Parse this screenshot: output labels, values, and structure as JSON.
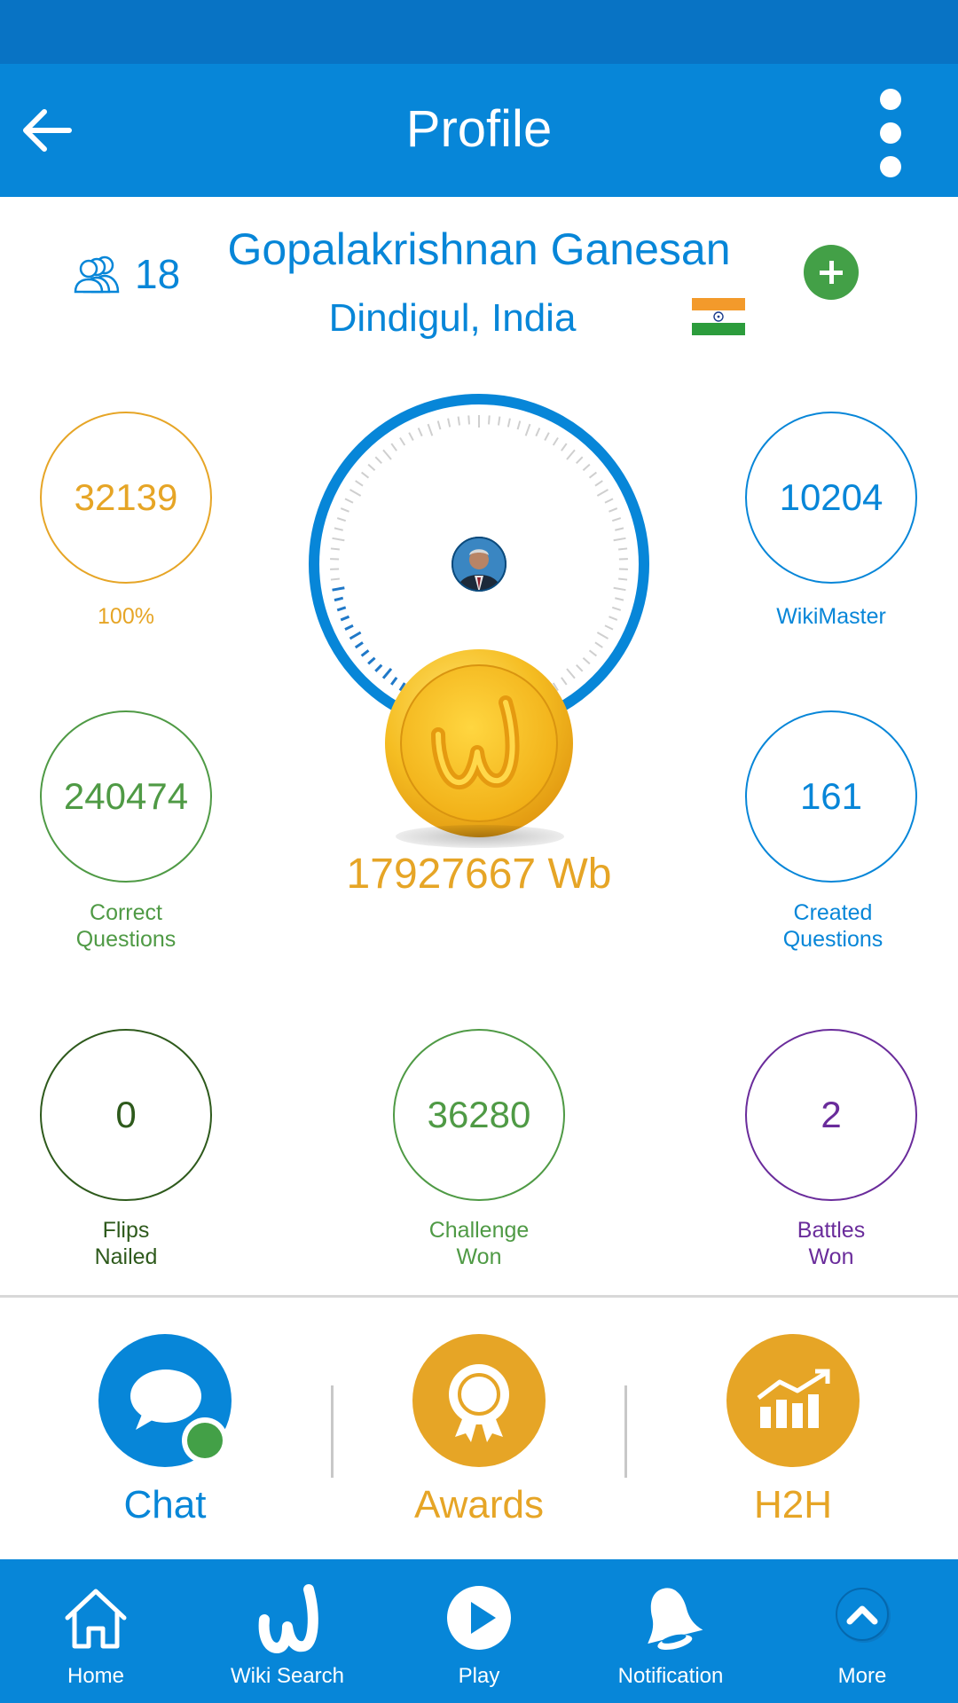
{
  "header": {
    "title": "Profile"
  },
  "profile": {
    "friends_count": "18",
    "name": "Gopalakrishnan Ganesan",
    "location": "Dindigul, India"
  },
  "stats": {
    "top_left": {
      "value": "32139",
      "label": "100%",
      "color": "#e6a526"
    },
    "top_right": {
      "value": "10204",
      "label": "WikiMaster",
      "color": "#0786d8"
    },
    "mid_left": {
      "value": "240474",
      "label_line1": "Correct",
      "label_line2": "Questions",
      "color": "#4f9a45"
    },
    "mid_right": {
      "value": "161",
      "label_line1": "Created",
      "label_line2": "Questions",
      "color": "#0786d8"
    },
    "bottom_left": {
      "value": "0",
      "label_line1": "Flips",
      "label_line2": "Nailed",
      "color": "#2e5a1c"
    },
    "bottom_mid": {
      "value": "36280",
      "label_line1": "Challenge",
      "label_line2": "Won",
      "color": "#4f9a45"
    },
    "bottom_right": {
      "value": "2",
      "label_line1": "Battles",
      "label_line2": "Won",
      "color": "#6a2c9b"
    }
  },
  "balance": "17927667 Wb",
  "actions": [
    {
      "label": "Chat",
      "color": "#0786d8",
      "icon": "chat-icon"
    },
    {
      "label": "Awards",
      "color": "#e6a526",
      "icon": "award-icon"
    },
    {
      "label": "H2H",
      "color": "#e6a526",
      "icon": "chart-icon"
    }
  ],
  "bottom_nav": [
    {
      "label": "Home",
      "icon": "home-icon"
    },
    {
      "label": "Wiki Search",
      "icon": "wiki-logo-icon"
    },
    {
      "label": "Play",
      "icon": "play-icon"
    },
    {
      "label": "Notification",
      "icon": "bell-icon"
    },
    {
      "label": "More",
      "icon": "chevron-up-icon"
    }
  ],
  "colors": {
    "primary": "#0786d8",
    "status_bar": "#0873c4",
    "gold": "#e6a526",
    "green": "#43a047"
  }
}
